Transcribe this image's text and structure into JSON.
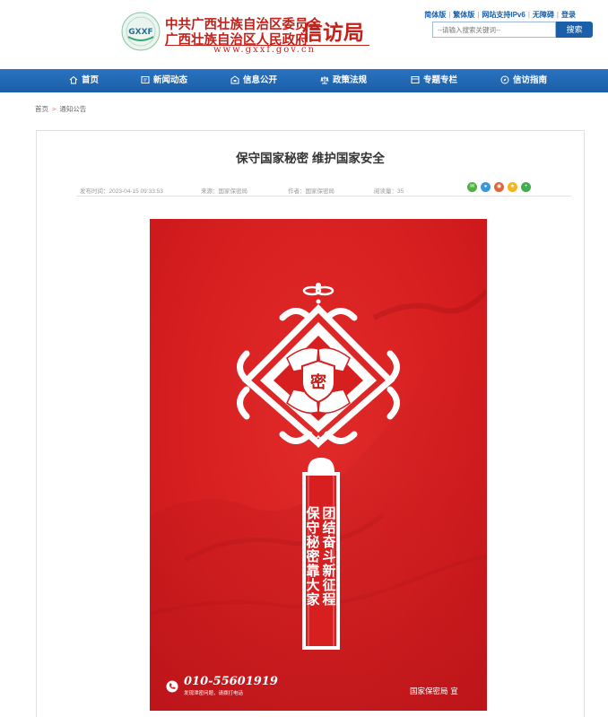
{
  "header": {
    "logo_emblem_text": "GXXF",
    "org_line1": "中共广西壮族自治区委员会",
    "org_line2": "广西壮族自治区人民政府",
    "bureau": "信访局",
    "url": "www.gxxf.gov.cn",
    "top_links": [
      "简体版",
      "繁体版",
      "网站支持IPv6",
      "无障碍",
      "登录"
    ],
    "search_placeholder": "--请输入搜索关键词--",
    "search_button": "搜索"
  },
  "nav": {
    "items": [
      {
        "label": "首页",
        "icon": "home-icon"
      },
      {
        "label": "新闻动态",
        "icon": "news-icon"
      },
      {
        "label": "信息公开",
        "icon": "info-icon"
      },
      {
        "label": "政策法规",
        "icon": "scale-icon"
      },
      {
        "label": "专题专栏",
        "icon": "topic-icon"
      },
      {
        "label": "信访指南",
        "icon": "compass-icon"
      }
    ]
  },
  "breadcrumb": {
    "home": "首页",
    "separator": ">",
    "current": "通知公告"
  },
  "article": {
    "title": "保守国家秘密 维护国家安全",
    "meta": {
      "published": "发布时间：2023-04-15 09:33:53",
      "source": "来源：国家保密局",
      "author": "作者：国家保密局",
      "views": "阅读量：35"
    },
    "share_icons": [
      "wechat-icon",
      "qq-icon",
      "weibo-icon",
      "qzone-icon",
      "more-icon"
    ]
  },
  "poster": {
    "emblem_char": "密",
    "slogan_right": "团结奋斗新征程",
    "slogan_left": "保守秘密靠大家",
    "phone": "010-55601919",
    "phone_sub": "发现泄密问题，请拨打电话",
    "signature": "国家保密局 宣"
  },
  "colors": {
    "brand_red": "#c2211a",
    "nav_blue": "#1b5ea7",
    "poster_red": "#d71f20"
  }
}
